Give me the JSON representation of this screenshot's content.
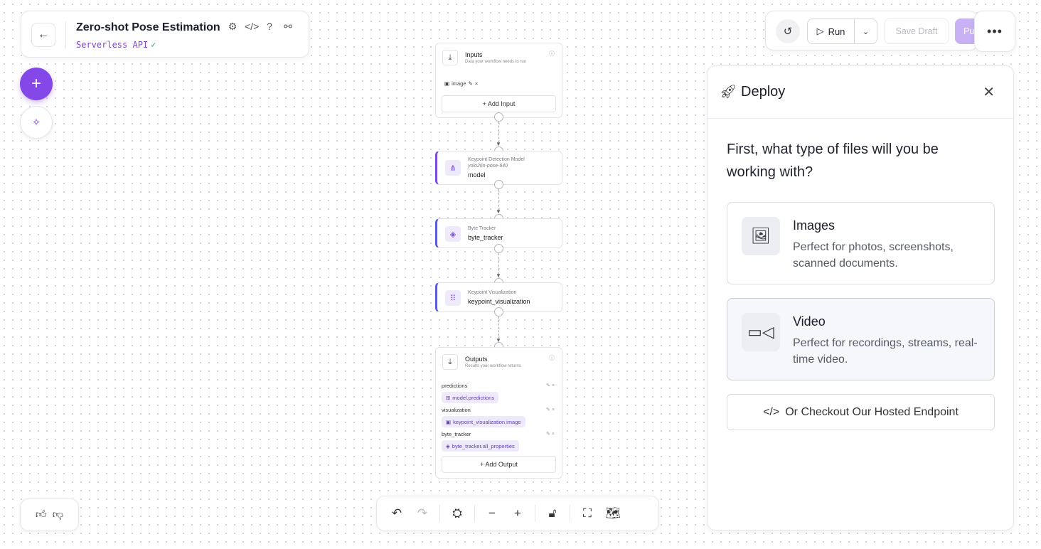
{
  "header": {
    "back_icon": "arrow-left-icon",
    "title": "Zero-shot Pose Estimation",
    "icons": [
      "gear-icon",
      "code-icon",
      "help-icon",
      "share-icon"
    ],
    "subtitle": "Serverless API",
    "subtitle_check": "✓"
  },
  "toolbar": {
    "run_label": "Run",
    "save_draft_label": "Save Draft",
    "publish_label_visible": "Pu",
    "more_label": "•••"
  },
  "nodes": {
    "inputs": {
      "title": "Inputs",
      "description": "Data your workflow needs to run",
      "input_chip": "image",
      "add_label": "+ Add Input"
    },
    "model": {
      "kind": "Keypoint Detection Model",
      "sub": "yolo26n-pose-640",
      "name": "model"
    },
    "tracker": {
      "kind": "Byte Tracker",
      "name": "byte_tracker"
    },
    "viz": {
      "kind": "Keypoint Visualization",
      "name": "keypoint_visualization"
    },
    "outputs": {
      "title": "Outputs",
      "description": "Results your workflow returns",
      "items": [
        {
          "label": "predictions",
          "value": "model.predictions"
        },
        {
          "label": "visualization",
          "value": "keypoint_visualization.image"
        },
        {
          "label": "byte_tracker",
          "value": "byte_tracker.all_properties"
        }
      ],
      "add_label": "+ Add Output"
    }
  },
  "deploy": {
    "title": "Deploy",
    "question": "First, what type of files will you be working with?",
    "options": [
      {
        "title": "Images",
        "desc": "Perfect for photos, screenshots, scanned documents.",
        "icon": "image-icon"
      },
      {
        "title": "Video",
        "desc": "Perfect for recordings, streams, real-time video.",
        "icon": "video-icon"
      }
    ],
    "hosted_label": "Or Checkout Our Hosted Endpoint"
  },
  "colors": {
    "accent": "#8447e8",
    "step_border": "#7b4bdb",
    "subtitle": "#7a46d4"
  }
}
